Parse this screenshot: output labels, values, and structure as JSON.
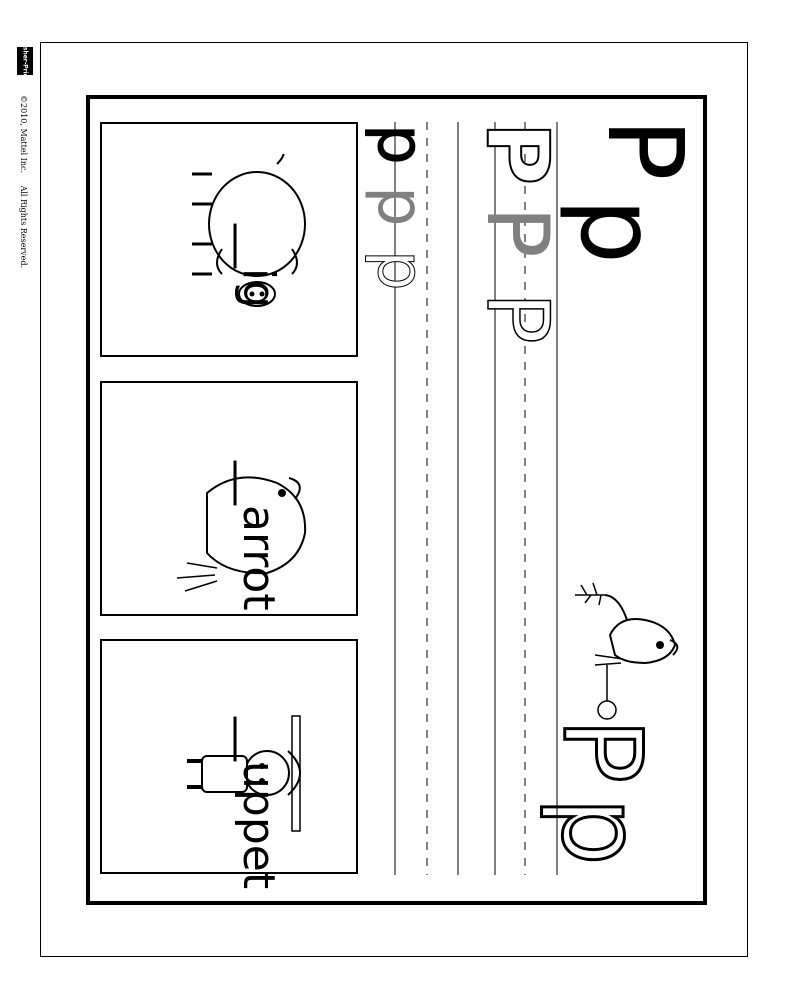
{
  "brand": {
    "logo_text": "Fisher-Price"
  },
  "copyright": {
    "text": "©2010, Mattel Inc.",
    "rights": "All Rights Reserved."
  },
  "letter": {
    "upper": "P",
    "lower": "p",
    "pair_upper": "P",
    "pair_lower": "p"
  },
  "trace_practice": {
    "upper_solid": "P",
    "upper_gray": "P",
    "upper_dotted": "P",
    "lower_solid": "p",
    "lower_gray": "p",
    "lower_dotted": "p"
  },
  "cards": [
    {
      "word": "__ig",
      "picture": "pig"
    },
    {
      "word": "__arrot",
      "picture": "parrot"
    },
    {
      "word": "__uppet",
      "picture": "puppet"
    }
  ],
  "colors": {
    "ink": "#000000",
    "trace_gray": "#808080"
  }
}
